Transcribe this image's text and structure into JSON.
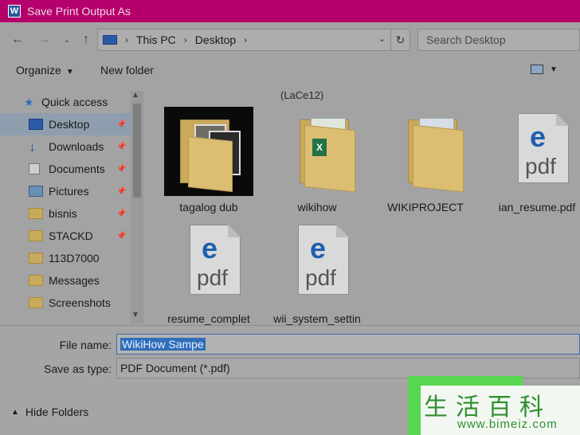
{
  "window": {
    "title": "Save Print Output As",
    "app_icon_letter": "W"
  },
  "nav": {
    "back_icon": "arrow-left-icon",
    "forward_icon": "arrow-right-icon",
    "recent_icon": "chevron-down-icon",
    "up_icon": "arrow-up-icon",
    "breadcrumb": [
      "This PC",
      "Desktop"
    ],
    "refresh_icon": "refresh-icon",
    "search_placeholder": "Search Desktop"
  },
  "toolbar": {
    "organize_label": "Organize",
    "new_folder_label": "New folder"
  },
  "sidebar": {
    "quick_access_label": "Quick access",
    "items": [
      {
        "label": "Desktop",
        "icon": "desktop-icon",
        "pinned": true,
        "selected": true
      },
      {
        "label": "Downloads",
        "icon": "download-icon",
        "pinned": true
      },
      {
        "label": "Documents",
        "icon": "documents-icon",
        "pinned": true
      },
      {
        "label": "Pictures",
        "icon": "pictures-icon",
        "pinned": true
      },
      {
        "label": "bisnis",
        "icon": "folder-icon",
        "pinned": true
      },
      {
        "label": "STACKD",
        "icon": "folder-icon",
        "pinned": true
      },
      {
        "label": "113D7000",
        "icon": "folder-icon",
        "pinned": false
      },
      {
        "label": "Messages",
        "icon": "folder-icon",
        "pinned": false
      },
      {
        "label": "Screenshots",
        "icon": "folder-icon",
        "pinned": false
      }
    ]
  },
  "content": {
    "group_header": "(LaCe12)",
    "files": [
      {
        "name": "tagalog dub",
        "type": "folder-photos"
      },
      {
        "name": "wikihow",
        "type": "folder-excel"
      },
      {
        "name": "WIKIPROJECT",
        "type": "folder-doc"
      },
      {
        "name": "ian_resume.pdf",
        "type": "pdf"
      },
      {
        "name": "resume_complet",
        "type": "pdf"
      },
      {
        "name": "wii_system_settin",
        "type": "pdf"
      }
    ],
    "pdf_label": "pdf",
    "pdf_glyph": "e"
  },
  "form": {
    "file_name_label": "File name:",
    "file_name_value": "WikiHow Sampe",
    "save_type_label": "Save as type:",
    "save_type_value": "PDF Document (*.pdf)",
    "hide_folders_label": "Hide Folders"
  },
  "watermark": {
    "text": "生活百科",
    "url": "www.bimeiz.com"
  },
  "colors": {
    "titlebar": "#b5006b",
    "selection": "#2f6eba",
    "watermark_green": "#57d74f"
  }
}
